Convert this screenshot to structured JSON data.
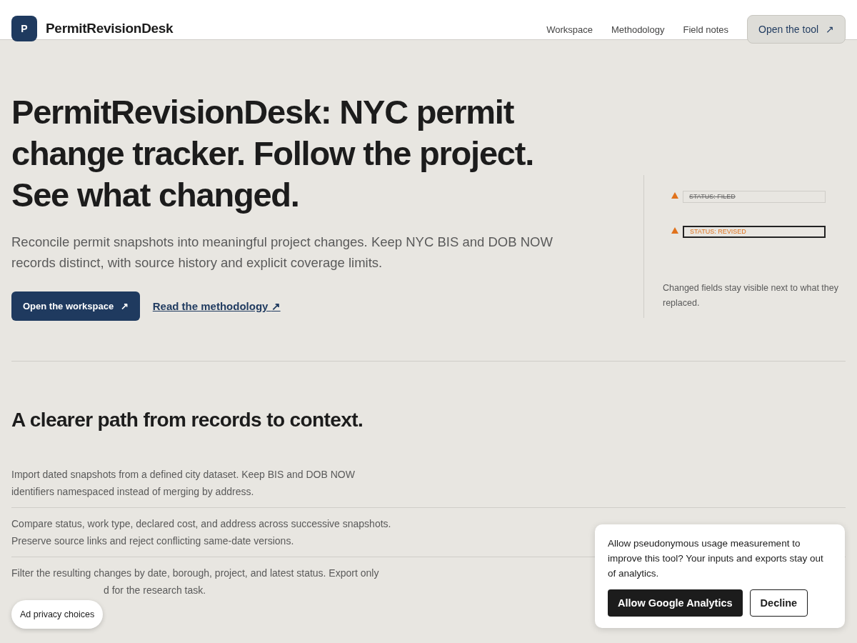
{
  "header": {
    "logo_letter": "P",
    "brand": "PermitRevisionDesk",
    "nav": [
      "Workspace",
      "Methodology",
      "Field notes"
    ],
    "cta": {
      "label": "Open the tool",
      "icon": "↗"
    }
  },
  "hero": {
    "title": "PermitRevisionDesk: NYC permit change tracker. Follow the project. See what changed.",
    "lead": "Reconcile permit snapshots into meaningful project changes. Keep NYC BIS and DOB NOW records distinct, with source history and explicit coverage limits.",
    "primary": {
      "label": "Open the workspace",
      "icon": "↗"
    },
    "secondary": {
      "label": "Read the methodology",
      "icon": "↗"
    },
    "diagram": {
      "fields": [
        {
          "kind": "old",
          "label": "STATUS: FILED"
        },
        {
          "kind": "new",
          "label": "STATUS: REVISED"
        }
      ],
      "caption": "Changed fields stay visible next to what they replaced."
    }
  },
  "section": {
    "heading": "A clearer path from records to context.",
    "items": [
      {
        "lines": [
          "Import dated snapshots from a defined city dataset. Keep BIS and DOB NOW",
          "identifiers namespaced instead of merging by address."
        ]
      },
      {
        "lines": [
          "Compare status, work type, declared cost, and address across successive snapshots.",
          "Preserve source links and reject conflicting same-date versions."
        ]
      },
      {
        "lines": [
          "Filter the resulting changes by date, borough, project, and latest status. Export only",
          "d for the research task."
        ],
        "covered_line_start": true
      }
    ]
  },
  "consent": {
    "text": "Allow pseudonymous usage measurement to improve this tool? Your inputs and exports stay out of analytics.",
    "accept": "Allow Google Analytics",
    "decline": "Decline"
  },
  "ad_choices": "Ad privacy choices"
}
